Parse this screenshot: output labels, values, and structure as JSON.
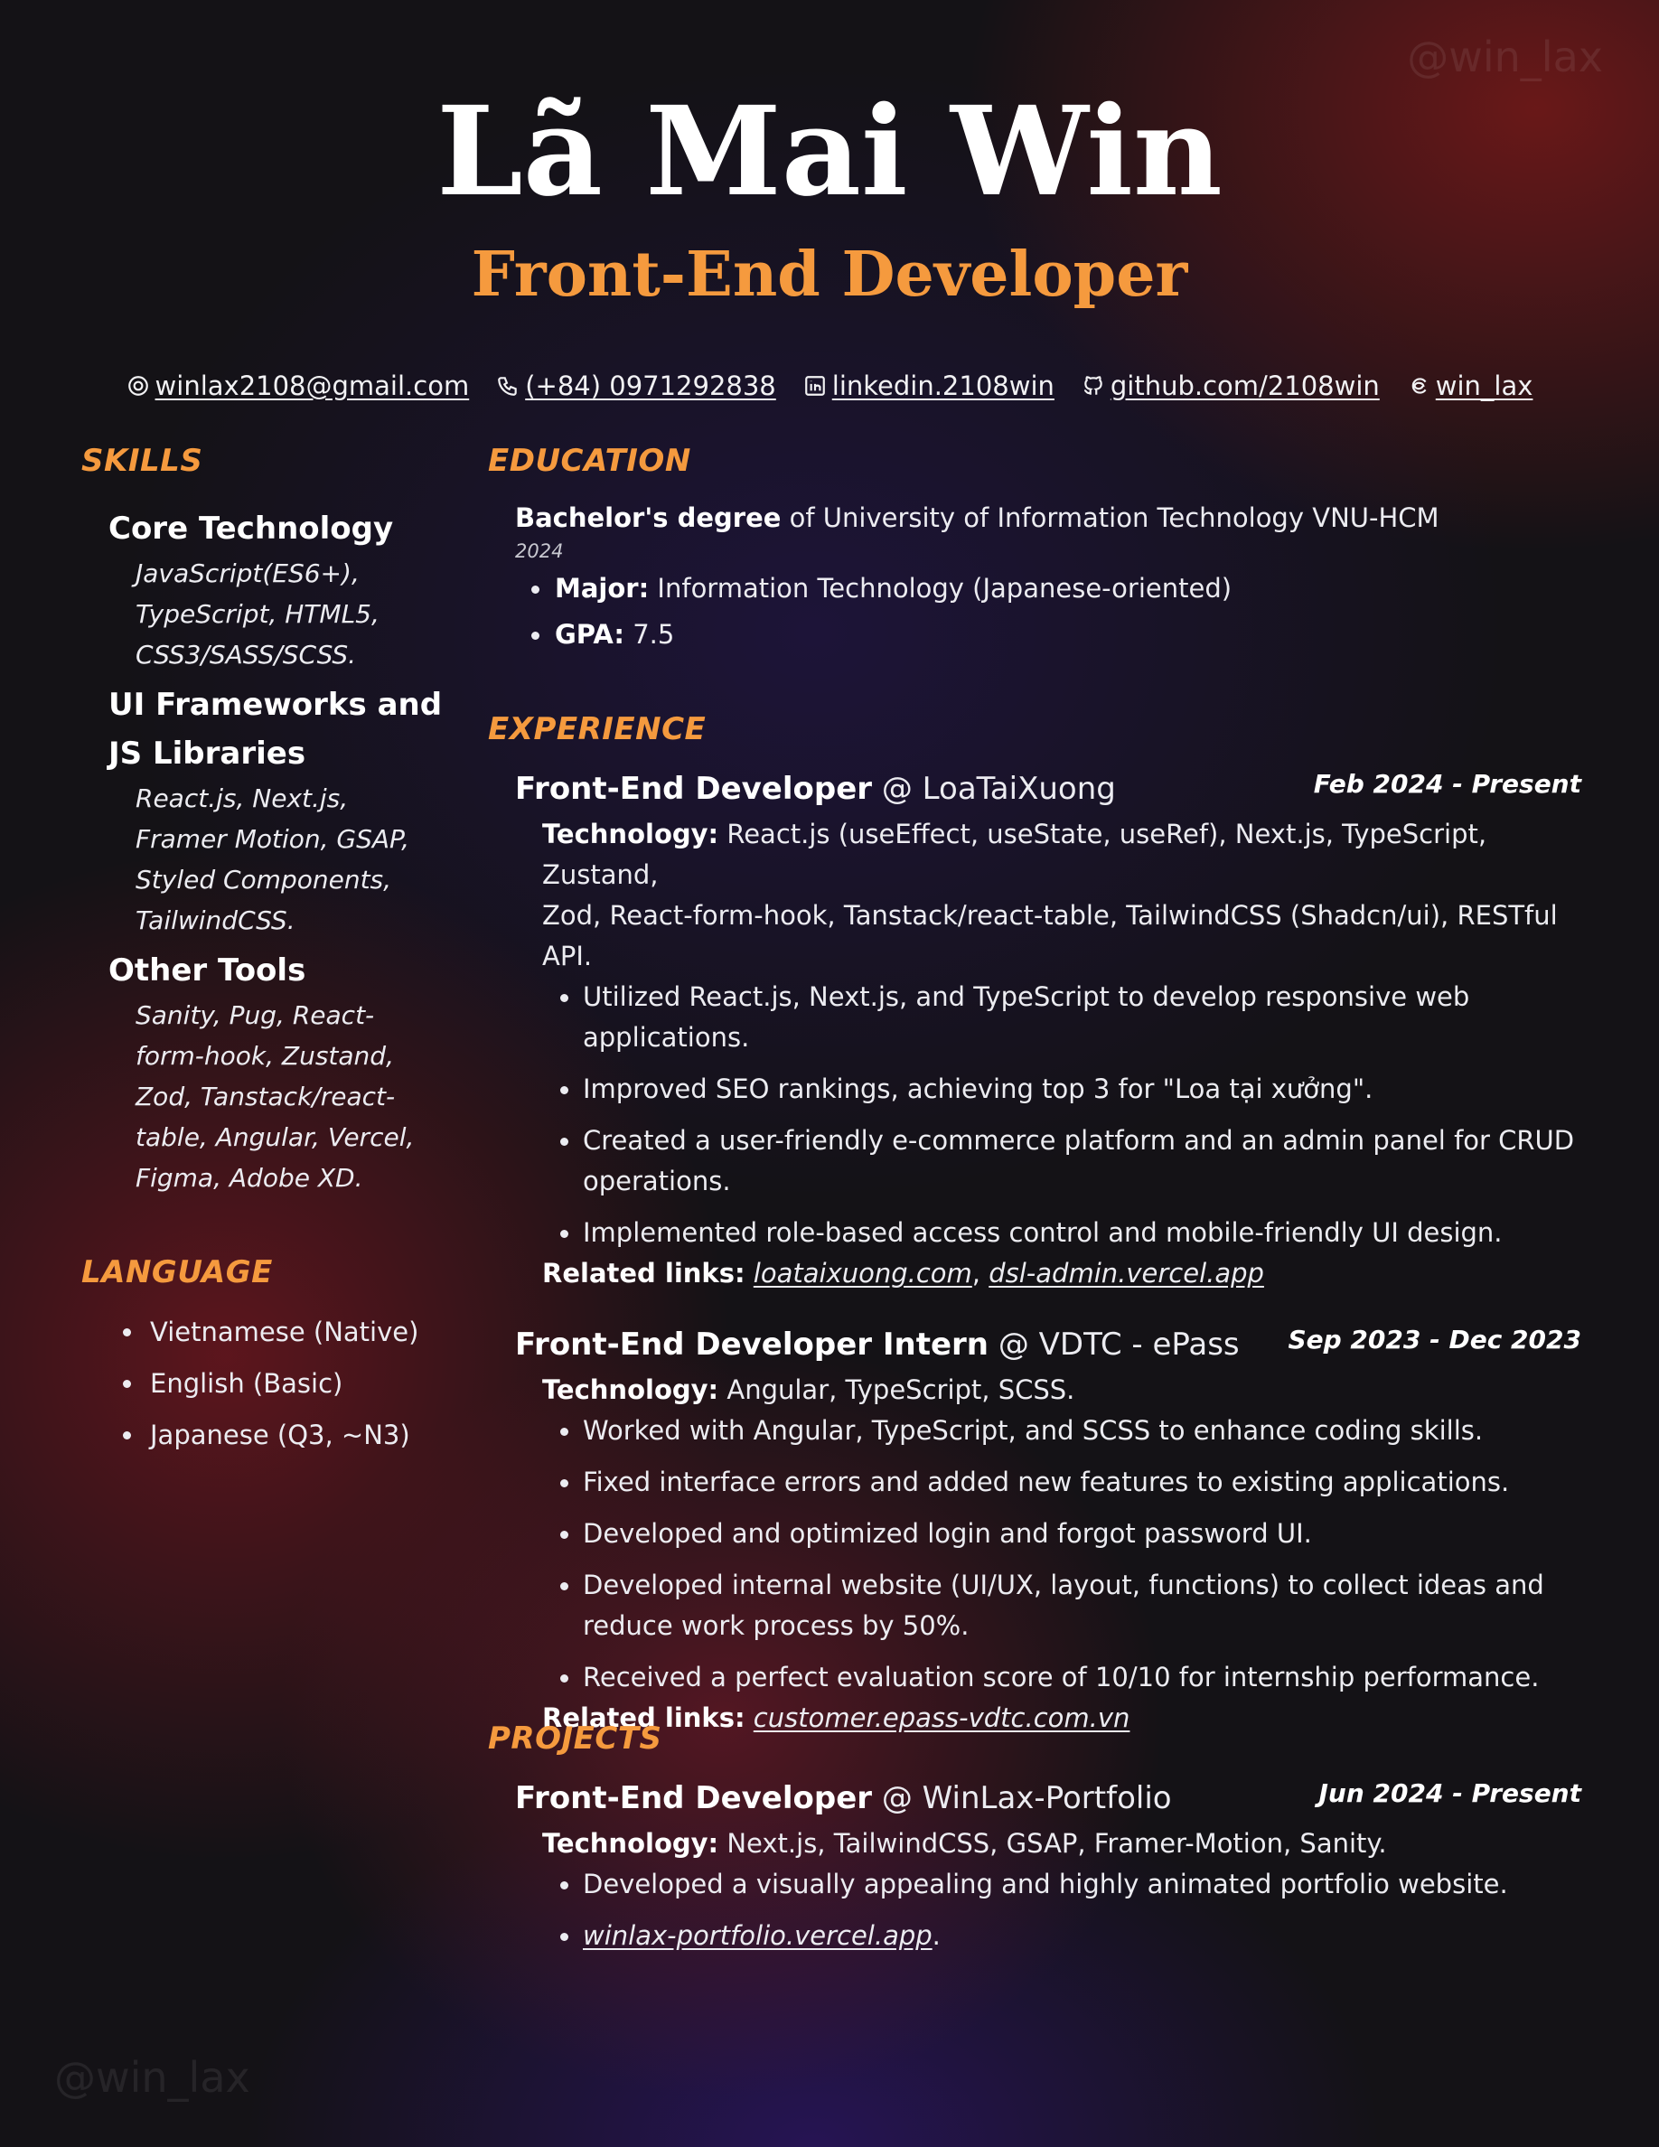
{
  "watermark": "@win_lax",
  "header": {
    "name": "Lã Mai Win",
    "role": "Front-End Developer",
    "contacts": {
      "email": "winlax2108@gmail.com",
      "phone": "(+84) 0971292838",
      "linkedin": "linkedin.2108win",
      "github": "github.com/2108win",
      "threads": "win_lax"
    }
  },
  "skills": {
    "title": "SKILLS",
    "groups": [
      {
        "heading": "Core Technology",
        "lines": [
          "JavaScript(ES6+),",
          "TypeScript, HTML5,",
          "CSS3/SASS/SCSS."
        ]
      },
      {
        "heading_lines": [
          "UI Frameworks and",
          "JS Libraries"
        ],
        "lines": [
          "React.js, Next.js,",
          "Framer Motion, GSAP,",
          "Styled Components,",
          "TailwindCSS."
        ]
      },
      {
        "heading": "Other Tools",
        "lines": [
          "Sanity, Pug, React-",
          "form-hook, Zustand,",
          "Zod, Tanstack/react-",
          "table, Angular, Vercel,",
          "Figma, Adobe XD."
        ]
      }
    ]
  },
  "language": {
    "title": "LANGUAGE",
    "items": [
      "Vietnamese (Native)",
      "English (Basic)",
      "Japanese (Q3, ~N3)"
    ]
  },
  "education": {
    "title": "EDUCATION",
    "degree": "Bachelor's degree",
    "of": "of",
    "school": "University of Information Technology VNU-HCM",
    "year": "2024",
    "major_label": "Major:",
    "major": "Information Technology (Japanese-oriented)",
    "gpa_label": "GPA:",
    "gpa": "7.5"
  },
  "experience": {
    "title": "EXPERIENCE",
    "tech_label": "Technology:",
    "links_label": "Related links:",
    "jobs": [
      {
        "position": "Front-End Developer",
        "company": "@ LoaTaiXuong",
        "date": "Feb 2024 - Present",
        "tech_lines": [
          "React.js (useEffect, useState, useRef), Next.js, TypeScript, Zustand,",
          "Zod, React-form-hook, Tanstack/react-table, TailwindCSS (Shadcn/ui), RESTful API."
        ],
        "bullets": [
          [
            "Utilized React.js, Next.js, and TypeScript to develop responsive web",
            "applications."
          ],
          [
            "Improved SEO rankings, achieving top 3 for \"Loa tại xưởng\"."
          ],
          [
            "Created a user-friendly e-commerce platform and an admin panel for CRUD",
            "operations."
          ],
          [
            "Implemented role-based access control and mobile-friendly UI design."
          ]
        ],
        "links": [
          "loataixuong.com",
          "dsl-admin.vercel.app"
        ]
      },
      {
        "position": "Front-End Developer Intern",
        "company": "@ VDTC - ePass",
        "date": "Sep 2023 - Dec 2023",
        "tech_lines": [
          "Angular, TypeScript, SCSS."
        ],
        "bullets": [
          [
            "Worked with Angular, TypeScript, and SCSS to enhance coding skills."
          ],
          [
            "Fixed interface errors and added new features to existing applications."
          ],
          [
            "Developed and optimized login and forgot password UI."
          ],
          [
            "Developed internal website (UI/UX, layout, functions) to collect ideas and",
            "reduce work process by 50%."
          ],
          [
            "Received a perfect evaluation score of 10/10 for internship performance."
          ]
        ],
        "links": [
          "customer.epass-vdtc.com.vn"
        ]
      }
    ]
  },
  "projects": {
    "title": "PROJECTS",
    "items": [
      {
        "position": "Front-End Developer",
        "company": "@ WinLax-Portfolio",
        "date": "Jun 2024 - Present",
        "tech": "Next.js, TailwindCSS, GSAP, Framer-Motion, Sanity.",
        "bullets": [
          "Developed a visually appealing and highly animated portfolio website."
        ],
        "link": "winlax-portfolio.vercel.app",
        "link_suffix": "."
      }
    ]
  }
}
